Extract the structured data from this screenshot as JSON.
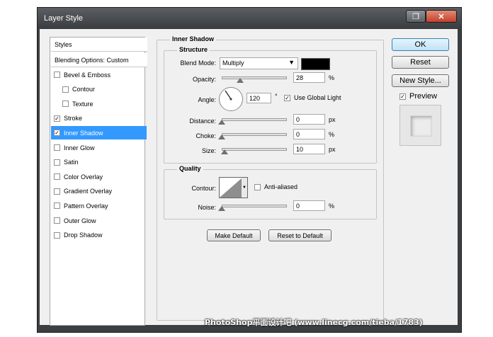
{
  "window": {
    "title": "Layer Style"
  },
  "styles_panel": {
    "header": "Styles",
    "blending": "Blending Options: Custom",
    "items": [
      {
        "label": "Bevel & Emboss",
        "checked": false,
        "indent": false,
        "selected": false
      },
      {
        "label": "Contour",
        "checked": false,
        "indent": true,
        "selected": false
      },
      {
        "label": "Texture",
        "checked": false,
        "indent": true,
        "selected": false
      },
      {
        "label": "Stroke",
        "checked": true,
        "indent": false,
        "selected": false
      },
      {
        "label": "Inner Shadow",
        "checked": true,
        "indent": false,
        "selected": true
      },
      {
        "label": "Inner Glow",
        "checked": false,
        "indent": false,
        "selected": false
      },
      {
        "label": "Satin",
        "checked": false,
        "indent": false,
        "selected": false
      },
      {
        "label": "Color Overlay",
        "checked": false,
        "indent": false,
        "selected": false
      },
      {
        "label": "Gradient Overlay",
        "checked": false,
        "indent": false,
        "selected": false
      },
      {
        "label": "Pattern Overlay",
        "checked": false,
        "indent": false,
        "selected": false
      },
      {
        "label": "Outer Glow",
        "checked": false,
        "indent": false,
        "selected": false
      },
      {
        "label": "Drop Shadow",
        "checked": false,
        "indent": false,
        "selected": false
      }
    ]
  },
  "inner_shadow": {
    "title": "Inner Shadow",
    "structure": {
      "title": "Structure",
      "blend_mode_label": "Blend Mode:",
      "blend_mode_value": "Multiply",
      "color": "#000000",
      "opacity_label": "Opacity:",
      "opacity_value": "28",
      "opacity_unit": "%",
      "opacity_level": 0.28,
      "angle_label": "Angle:",
      "angle_value": "120",
      "angle_unit": "°",
      "use_global_light_label": "Use Global Light",
      "use_global_light": true,
      "distance_label": "Distance:",
      "distance_value": "0",
      "distance_unit": "px",
      "distance_level": 0,
      "choke_label": "Choke:",
      "choke_value": "0",
      "choke_unit": "%",
      "choke_level": 0,
      "size_label": "Size:",
      "size_value": "10",
      "size_unit": "px",
      "size_level": 0.04
    },
    "quality": {
      "title": "Quality",
      "contour_label": "Contour:",
      "anti_aliased_label": "Anti-aliased",
      "anti_aliased": false,
      "noise_label": "Noise:",
      "noise_value": "0",
      "noise_unit": "%",
      "noise_level": 0
    },
    "make_default": "Make Default",
    "reset_to_default": "Reset to Default"
  },
  "buttons": {
    "ok": "OK",
    "reset": "Reset",
    "new_style": "New Style...",
    "preview_label": "Preview",
    "preview_checked": true
  },
  "watermark": "PhotoShop平面设计吧 (www.linecg.com/tieba/1783)"
}
